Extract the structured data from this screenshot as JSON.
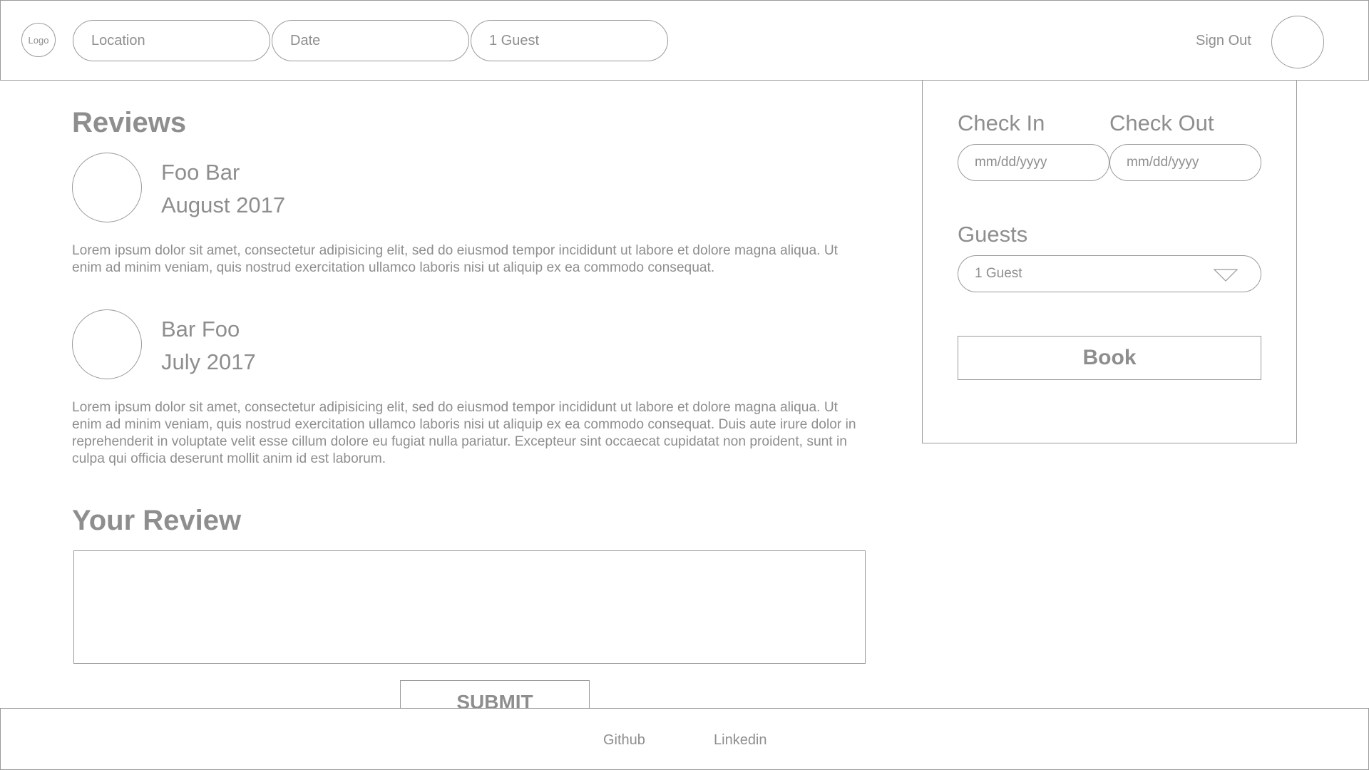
{
  "header": {
    "logo_label": "Logo",
    "search": {
      "location_placeholder": "Location",
      "date_placeholder": "Date",
      "guest_value": "1 Guest"
    },
    "sign_out_label": "Sign Out"
  },
  "reviews": {
    "heading": "Reviews",
    "items": [
      {
        "name": "Foo Bar",
        "date": "August 2017",
        "body": "Lorem ipsum dolor sit amet, consectetur adipisicing elit, sed do eiusmod tempor incididunt ut labore et dolore magna aliqua. Ut enim ad minim veniam, quis nostrud exercitation ullamco laboris nisi ut aliquip ex ea commodo consequat."
      },
      {
        "name": "Bar Foo",
        "date": "July 2017",
        "body": "Lorem ipsum dolor sit amet, consectetur adipisicing elit, sed do eiusmod tempor incididunt ut labore et dolore magna aliqua. Ut enim ad minim veniam, quis nostrud exercitation ullamco laboris nisi ut aliquip ex ea commodo consequat. Duis aute irure dolor in reprehenderit in voluptate velit esse cillum dolore eu fugiat nulla pariatur. Excepteur sint occaecat cupidatat non proident, sunt in culpa qui officia deserunt mollit anim id est laborum."
      }
    ]
  },
  "your_review": {
    "heading": "Your Review",
    "textarea_value": "",
    "submit_label": "SUBMIT"
  },
  "booking": {
    "check_in_label": "Check In",
    "check_out_label": "Check Out",
    "check_in_placeholder": "mm/dd/yyyy",
    "check_out_placeholder": "mm/dd/yyyy",
    "guests_label": "Guests",
    "guests_selected": "1 Guest",
    "book_label": "Book"
  },
  "footer": {
    "links": [
      "Github",
      "Linkedin"
    ]
  },
  "colors": {
    "border": "#9a9a9a",
    "text": "#8e8e8e",
    "background": "#ffffff"
  },
  "icons": {
    "dropdown": "chevron-down-icon"
  }
}
